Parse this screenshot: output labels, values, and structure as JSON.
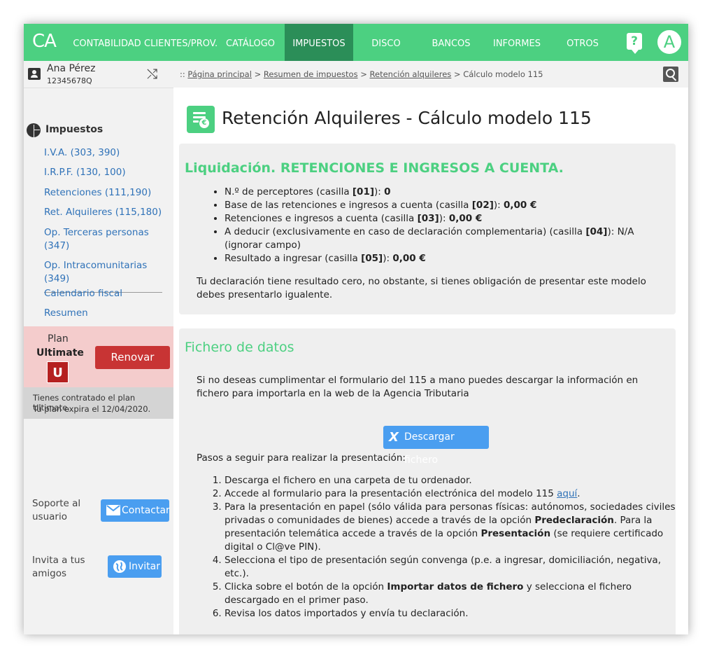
{
  "nav": {
    "logo": "CA",
    "items": [
      "CONTABILIDAD",
      "CLIENTES/PROV.",
      "CATÁLOGO",
      "IMPUESTOS",
      "DISCO VIRTUAL",
      "BANCOS",
      "INFORMES",
      "OTROS"
    ],
    "active": "IMPUESTOS",
    "help_icon": "?",
    "avatar_letter": "A"
  },
  "user": {
    "name": "Ana Pérez",
    "id": "12345678Q"
  },
  "sidebar": {
    "section_title": "Impuestos",
    "links": [
      "I.V.A. (303, 390)",
      "I.R.P.F. (130, 100)",
      "Retenciones (111,190)",
      "Ret. Alquileres (115,180)",
      "Op. Terceras personas (347)",
      "Op. Intracomunitarias (349)"
    ],
    "links2": [
      "Calendario fiscal",
      "Resumen"
    ],
    "plan": {
      "label": "Plan",
      "name": "Ultimate",
      "badge": "U",
      "renew": "Renovar",
      "info_line1": "Tienes contratado el plan Ultimate.",
      "info_line2": "Tu plan expira el 12/04/2020."
    },
    "support": {
      "label_line1": "Soporte al",
      "label_line2": "usuario",
      "button": "Contactar"
    },
    "invite": {
      "label_line1": "Invita a tus",
      "label_line2": "amigos",
      "button": "Invitar"
    }
  },
  "breadcrumb": {
    "prefix": ":: ",
    "items": [
      "Página principal",
      "Resumen de impuestos",
      "Retención alquileres"
    ],
    "sep": " > ",
    "current": "Cálculo modelo 115"
  },
  "page": {
    "title": "Retención Alquileres - Cálculo modelo 115"
  },
  "liquidacion": {
    "title": "Liquidación. RETENCIONES E INGRESOS A CUENTA.",
    "items": [
      {
        "pre": "N.º de perceptores (casilla ",
        "box": "[01]",
        "post": "): ",
        "value": "0"
      },
      {
        "pre": "Base de las retenciones e ingresos a cuenta (casilla ",
        "box": "[02]",
        "post": "): ",
        "value": "0,00 €"
      },
      {
        "pre": "Retenciones e ingresos a cuenta (casilla ",
        "box": "[03]",
        "post": "): ",
        "value": "0,00 €"
      },
      {
        "pre": "A deducir (exclusivamente en caso de declaración complementaria) (casilla ",
        "box": "[04]",
        "post": "): ",
        "value": "N/A (ignorar campo)"
      },
      {
        "pre": "Resultado a ingresar (casilla ",
        "box": "[05]",
        "post": "): ",
        "value": "0,00 €"
      }
    ],
    "note": "Tu declaración tiene resultado cero, no obstante, si tienes obligación de presentar este modelo debes presentarlo igualente."
  },
  "fichero": {
    "title": "Fichero de datos",
    "intro": "Si no deseas cumplimentar el formulario del 115 a mano puedes descargar la información en fichero para importarla en la web de la Agencia Tributaria",
    "button": "Descargar fichero",
    "steps_title": "Pasos a seguir para realizar la presentación:",
    "step1": "Descarga el fichero en una carpeta de tu ordenador.",
    "step2_pre": "Accede al formulario para la presentación electrónica del modelo 115 ",
    "step2_link": "aquí",
    "step2_post": ".",
    "step3_a": "Para la presentación en papel (sólo válida para personas físicas: autónomos, sociedades civiles privadas o comunidades de bienes) accede a través de la opción ",
    "step3_b": "Predeclaración",
    "step3_c": ". Para la presentación telemática accede a través de la opción ",
    "step3_d": "Presentación",
    "step3_e": " (se requiere certificado digital o Cl@ve PIN).",
    "step4": "Selecciona el tipo de presentación según convenga (p.e. a ingresar, domiciliación, negativa, etc.).",
    "step5_a": "Clicka sobre el botón de la opción ",
    "step5_b": "Importar datos de fichero",
    "step5_c": " y selecciona el fichero descargado en el primer paso.",
    "step6": "Revisa los datos importados y envía tu declaración."
  }
}
